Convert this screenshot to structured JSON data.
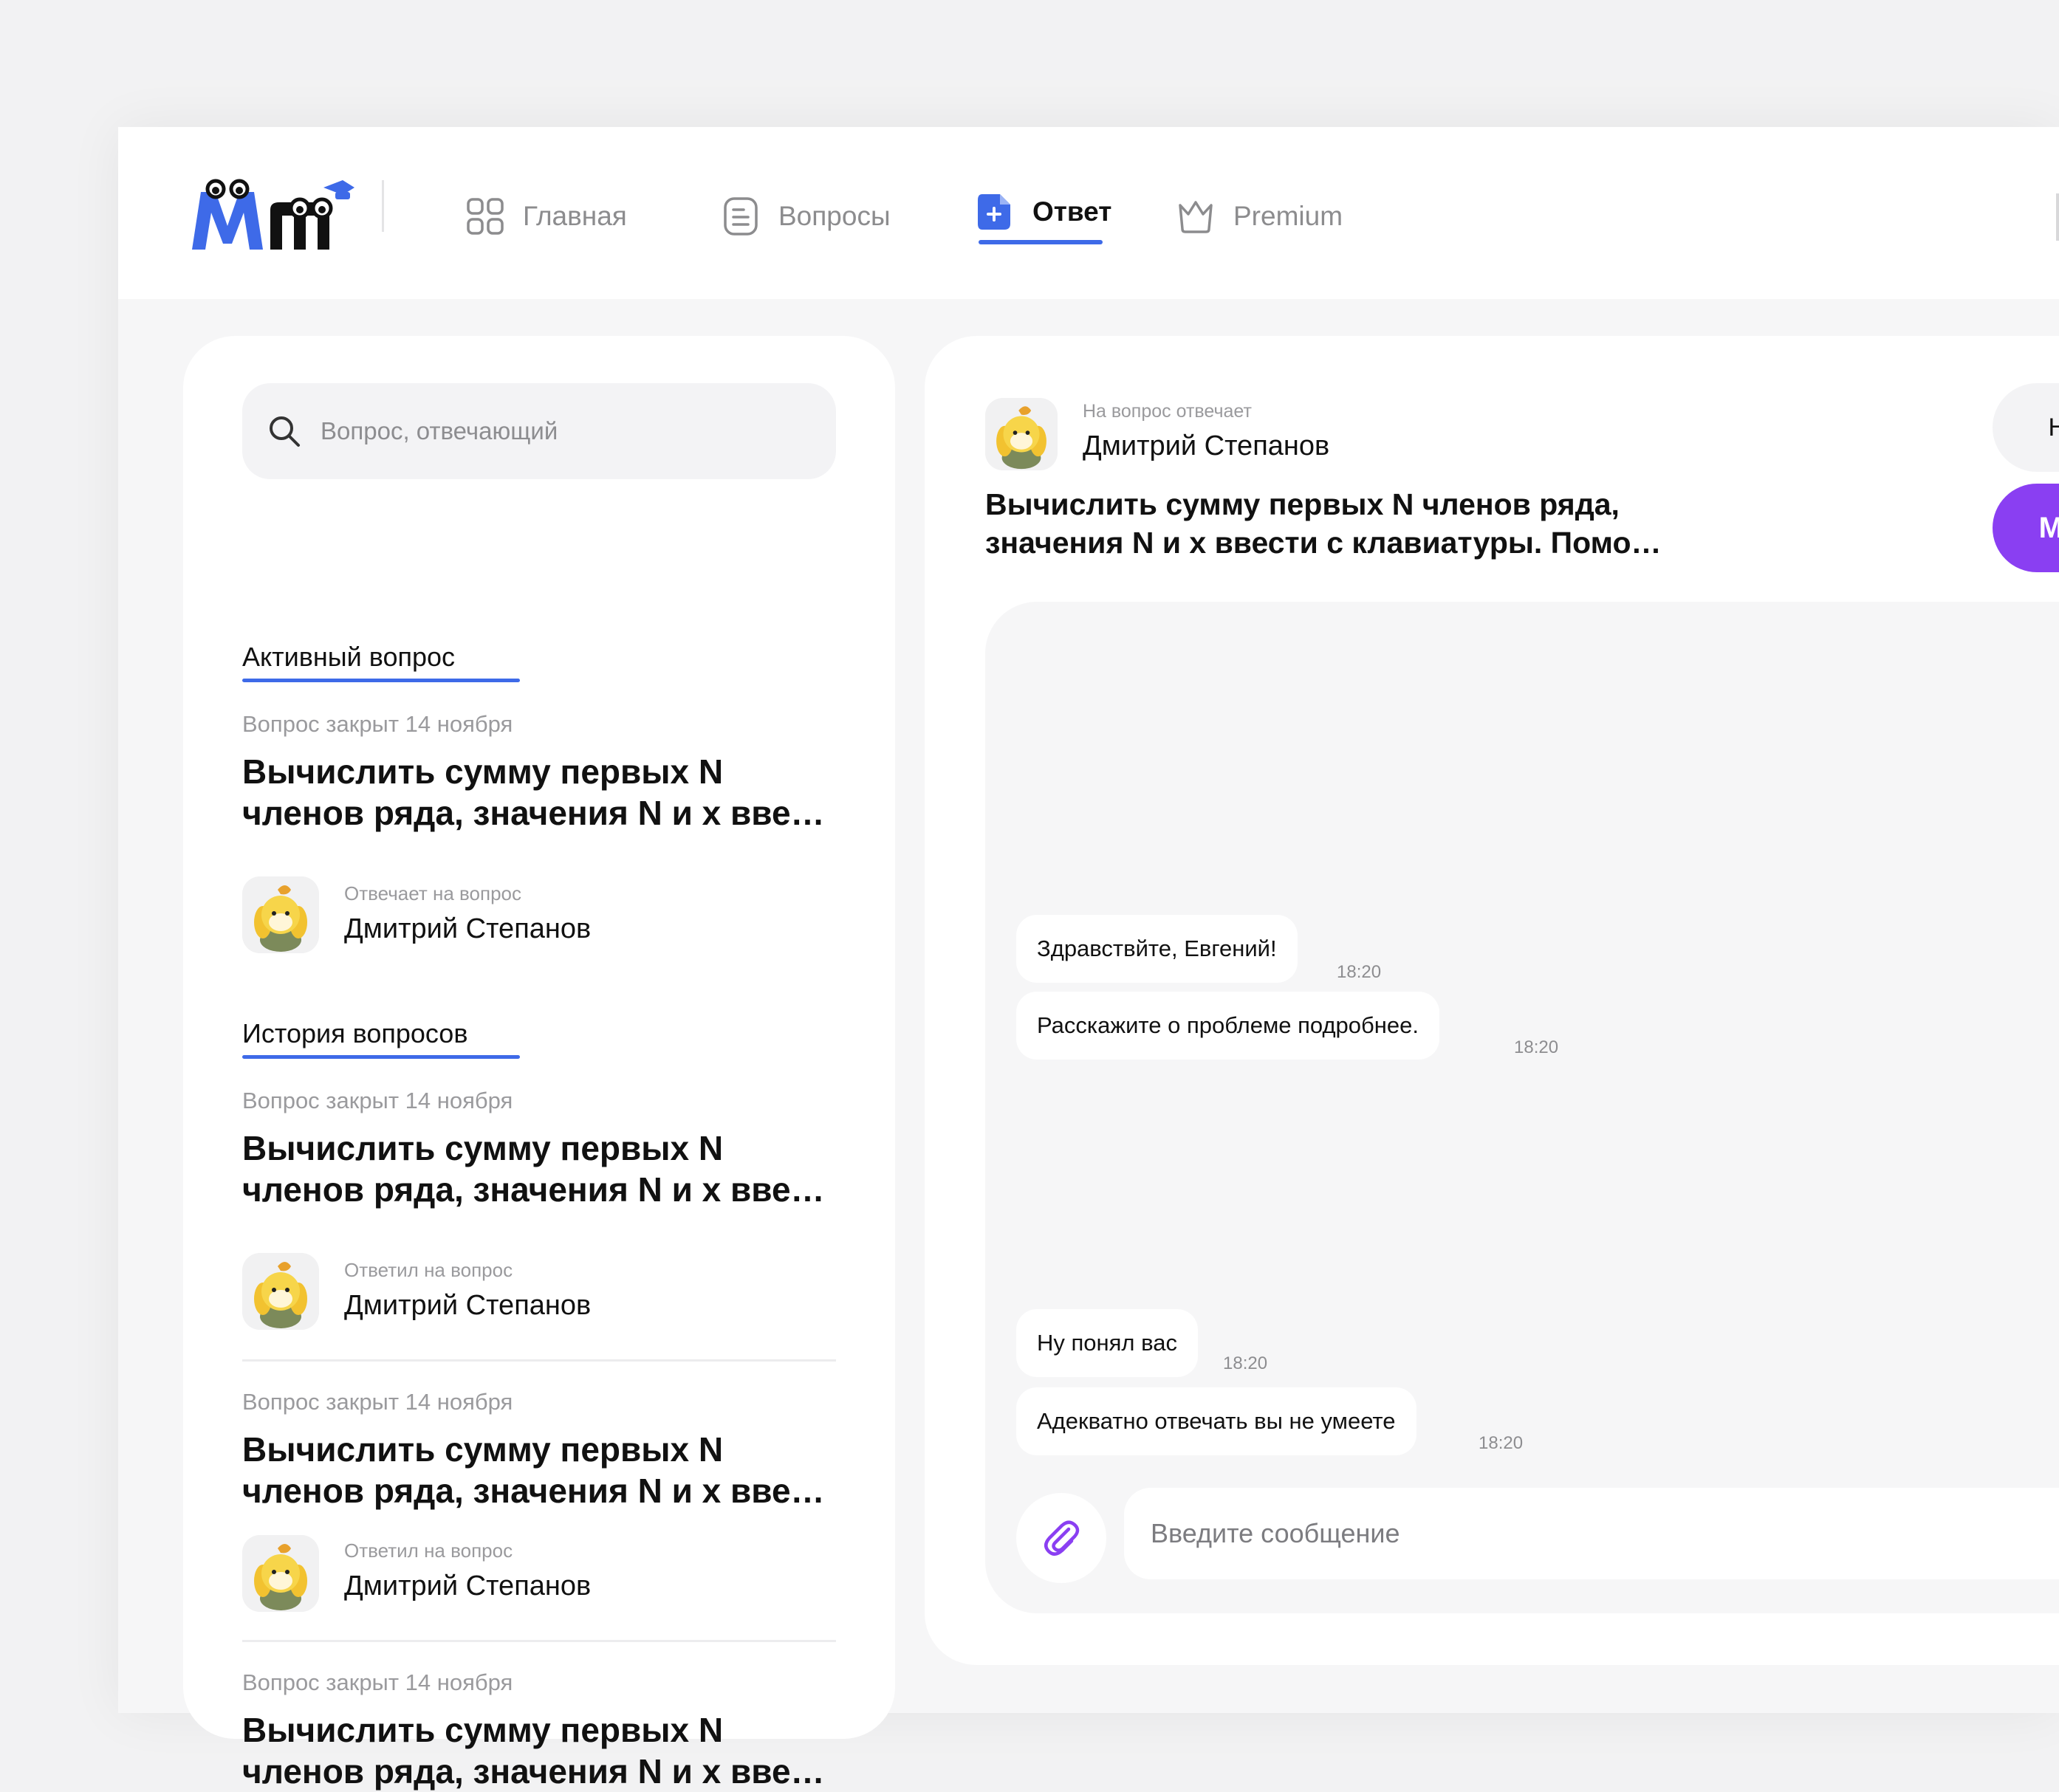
{
  "nav": {
    "items": [
      {
        "label": "Главная",
        "icon": "grid-icon"
      },
      {
        "label": "Вопросы",
        "icon": "document-list-icon"
      },
      {
        "label": "Ответ",
        "icon": "document-plus-icon"
      },
      {
        "label": "Premium",
        "icon": "crown-icon"
      }
    ],
    "active_index": 2
  },
  "colors": {
    "accent": "#3e6ae8",
    "purple": "#8a3ff2",
    "logo_blue": "#3e6ae8"
  },
  "search": {
    "placeholder": "Вопрос, отвечающий"
  },
  "active_section": {
    "title": "Активный вопрос",
    "question": {
      "date": "Вопрос закрыт 14 ноября",
      "text": "Вычислить сумму первых N членов ряда, значения N и х вве…",
      "answer_label": "Отвечает на вопрос",
      "answerer": "Дмитрий Степанов"
    }
  },
  "history_section": {
    "title": "История вопросов",
    "questions": [
      {
        "date": "Вопрос закрыт 14 ноября",
        "text": "Вычислить сумму первых N членов ряда, значения N и х вве…",
        "answer_label": "Ответил на вопрос",
        "answerer": "Дмитрий Степанов"
      },
      {
        "date": "Вопрос закрыт 14 ноября",
        "text": "Вычислить сумму первых N членов ряда, значения N и х вве…",
        "answer_label": "Ответил на вопрос",
        "answerer": "Дмитрий Степанов"
      },
      {
        "date": "Вопрос закрыт 14 ноября",
        "text": "Вычислить сумму первых N членов ряда, значения N и х вве…"
      }
    ]
  },
  "chat": {
    "label": "На вопрос отвечает",
    "name": "Дмитрий Степанов",
    "question": "Вычислить сумму первых N членов ряда, значения N и х ввести с клавиатуры. Помо…",
    "right_pill_1": "Н",
    "right_pill_2": "М",
    "messages": [
      {
        "text": "Здравствйте, Евгений!",
        "time": "18:20"
      },
      {
        "text": "Расскажите о проблеме подробнее.",
        "time": "18:20"
      },
      {
        "text": "Ну понял вас",
        "time": "18:20"
      },
      {
        "text": "Адекватно отвечать вы не умеете",
        "time": "18:20"
      }
    ],
    "input_placeholder": "Введите сообщение"
  }
}
